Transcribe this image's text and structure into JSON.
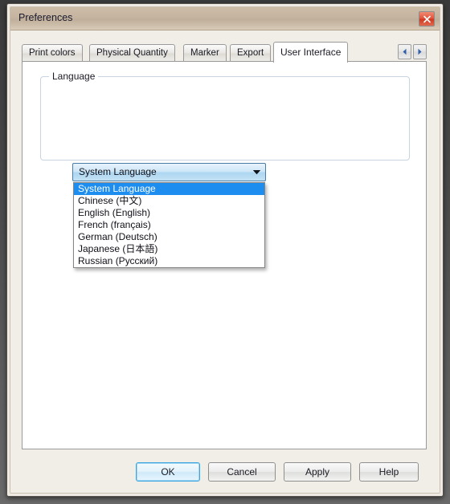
{
  "window": {
    "title": "Preferences",
    "close_icon": "close-x-icon"
  },
  "tabs": {
    "items": [
      {
        "label": "Print colors",
        "active": false
      },
      {
        "label": "Physical Quantity",
        "active": false
      },
      {
        "label": "Marker",
        "active": false
      },
      {
        "label": "Export",
        "active": false
      },
      {
        "label": "User Interface",
        "active": true
      }
    ],
    "nav_prev_icon": "triangle-left-icon",
    "nav_next_icon": "triangle-right-icon"
  },
  "group": {
    "label": "Language"
  },
  "combobox": {
    "value": "System Language",
    "arrow_icon": "chevron-down-icon",
    "expanded": true,
    "options": [
      "System Language",
      "Chinese (中文)",
      "English (English)",
      "French (français)",
      "German (Deutsch)",
      "Japanese (日本語)",
      "Russian (Русский)"
    ],
    "selected_index": 0
  },
  "buttons": {
    "ok": "OK",
    "cancel": "Cancel",
    "apply": "Apply",
    "help": "Help"
  },
  "colors": {
    "titlebar": "#c5b4a0",
    "accent_blue": "#1d8df0",
    "close_red": "#e2523a",
    "default_border": "#3aa5e0"
  }
}
